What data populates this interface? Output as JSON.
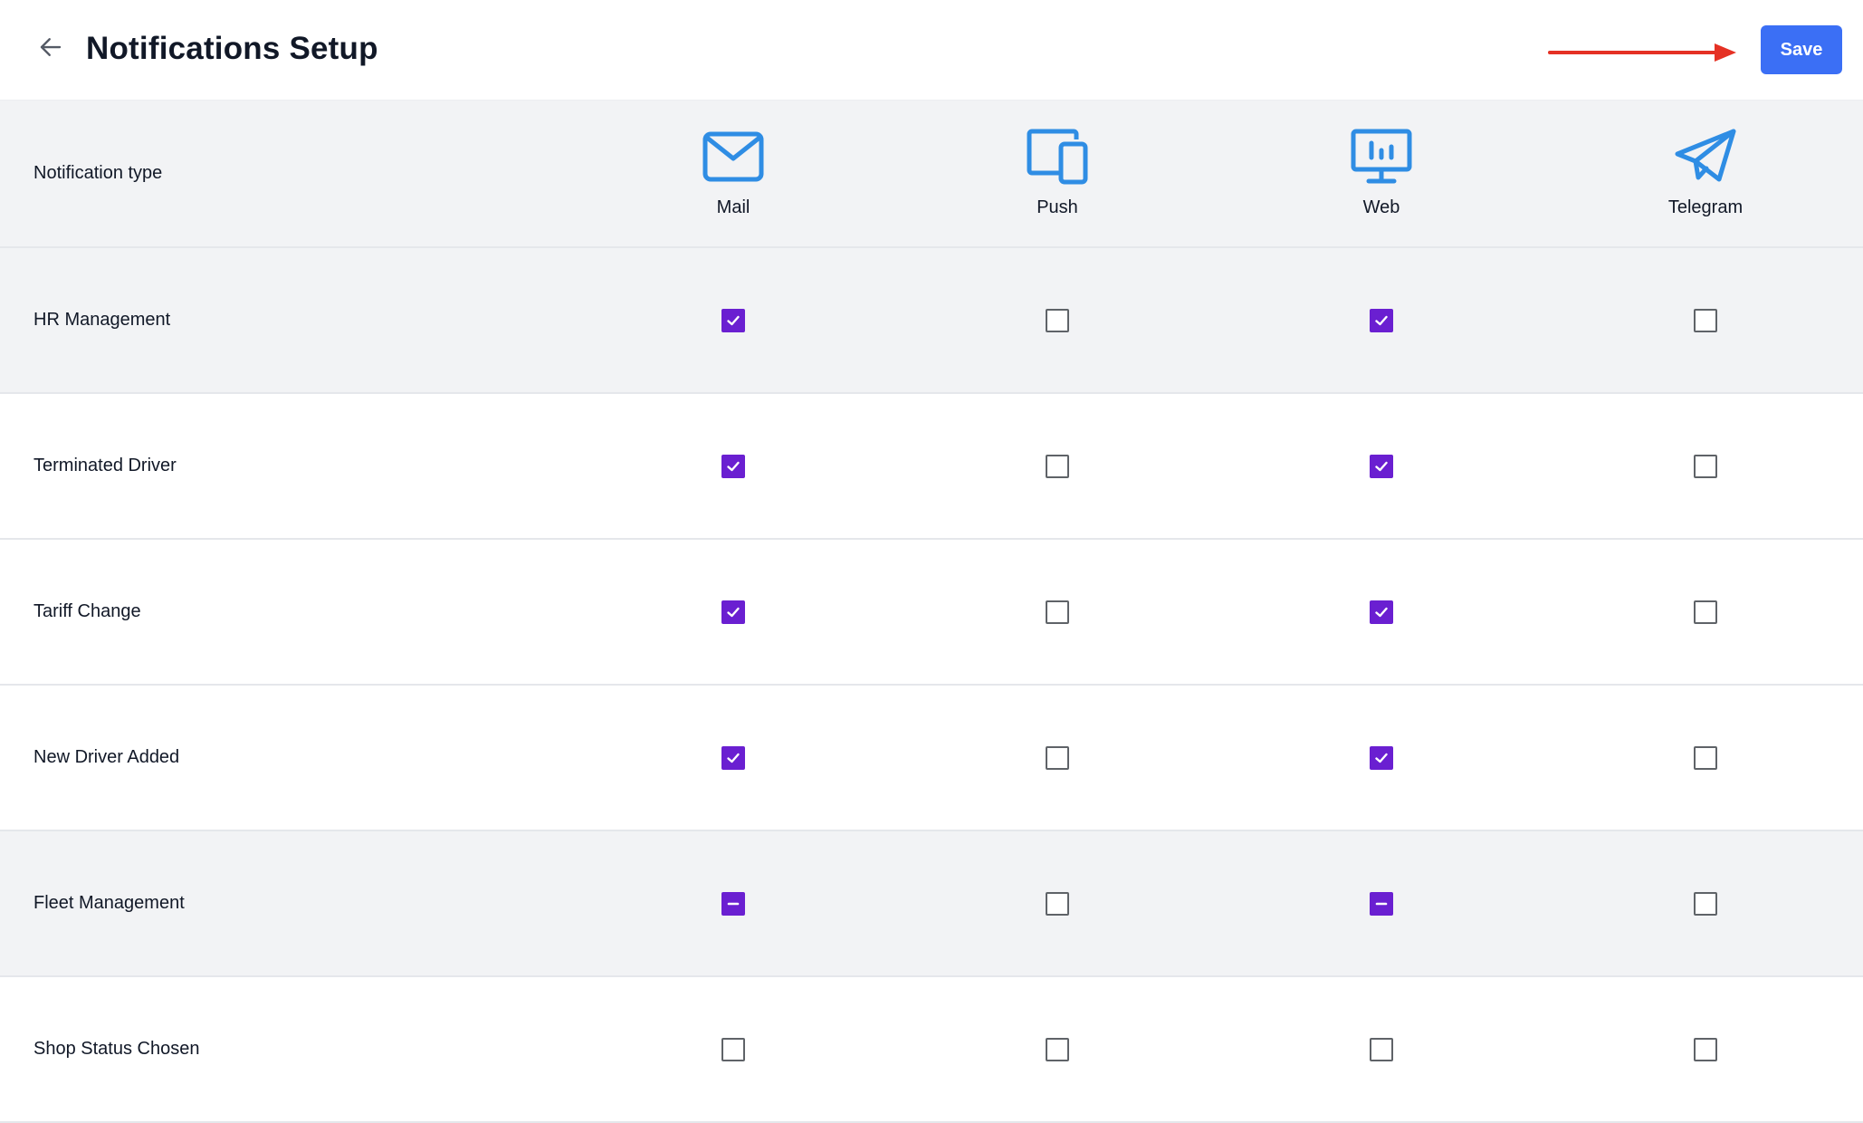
{
  "header": {
    "title": "Notifications Setup",
    "save_label": "Save",
    "back_icon": "arrow-left-icon"
  },
  "colors": {
    "accent": "#3b6ff5",
    "checkbox": "#6a1fd1",
    "icon": "#2f8de4",
    "annotation_arrow": "#e53124",
    "row_gray": "#f2f3f5"
  },
  "table": {
    "type_header": "Notification type",
    "channels": [
      {
        "label": "Mail",
        "icon": "mail-icon"
      },
      {
        "label": "Push",
        "icon": "devices-icon"
      },
      {
        "label": "Web",
        "icon": "monitor-icon"
      },
      {
        "label": "Telegram",
        "icon": "paper-plane-icon"
      }
    ],
    "rows": [
      {
        "label": "HR Management",
        "states": [
          "checked",
          "unchecked",
          "checked",
          "unchecked"
        ],
        "shaded": true
      },
      {
        "label": "Terminated Driver",
        "states": [
          "checked",
          "unchecked",
          "checked",
          "unchecked"
        ],
        "shaded": false
      },
      {
        "label": "Tariff Change",
        "states": [
          "checked",
          "unchecked",
          "checked",
          "unchecked"
        ],
        "shaded": false
      },
      {
        "label": "New Driver Added",
        "states": [
          "checked",
          "unchecked",
          "checked",
          "unchecked"
        ],
        "shaded": false
      },
      {
        "label": "Fleet Management",
        "states": [
          "indeterminate",
          "unchecked",
          "indeterminate",
          "unchecked"
        ],
        "shaded": true
      },
      {
        "label": "Shop Status Chosen",
        "states": [
          "unchecked",
          "unchecked",
          "unchecked",
          "unchecked"
        ],
        "shaded": false
      }
    ]
  }
}
